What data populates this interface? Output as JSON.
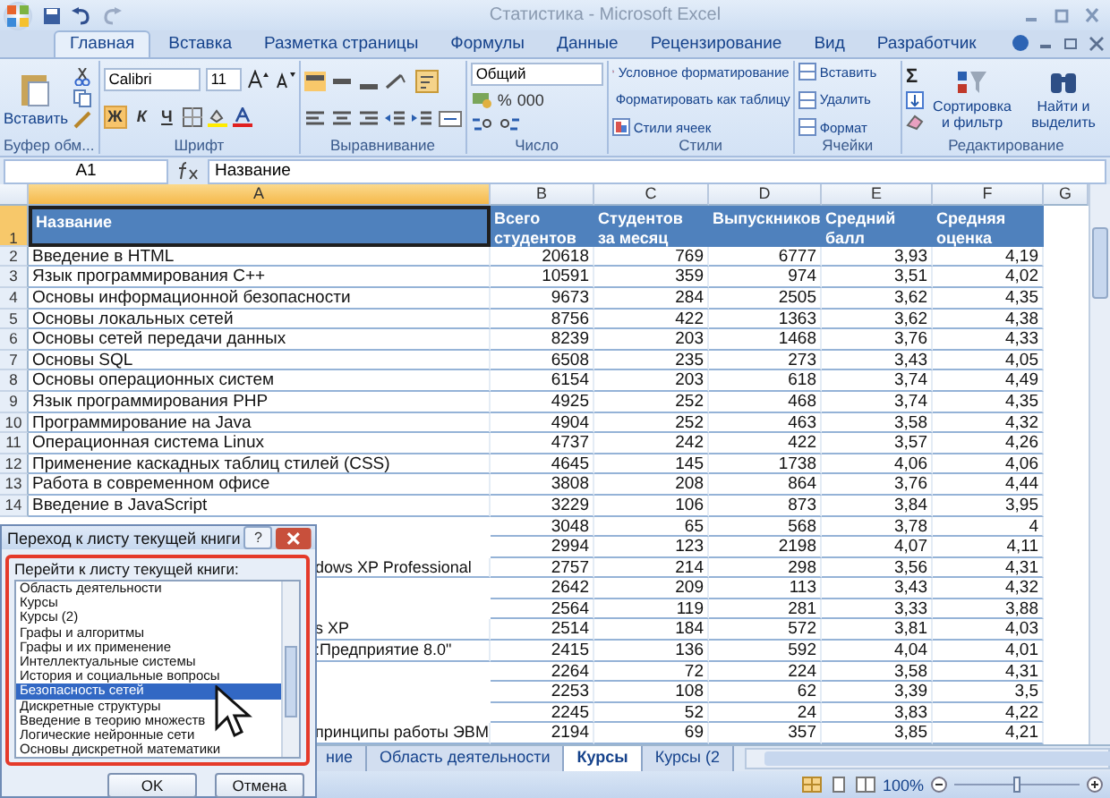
{
  "window": {
    "title": "Статистика - Microsoft Excel"
  },
  "ribbon_tabs": [
    {
      "label": "Главная",
      "selected": true
    },
    {
      "label": "Вставка",
      "selected": false
    },
    {
      "label": "Разметка страницы",
      "selected": false
    },
    {
      "label": "Формулы",
      "selected": false
    },
    {
      "label": "Данные",
      "selected": false
    },
    {
      "label": "Рецензирование",
      "selected": false
    },
    {
      "label": "Вид",
      "selected": false
    },
    {
      "label": "Разработчик",
      "selected": false
    }
  ],
  "ribbon": {
    "clipboard": {
      "paste": "Вставить",
      "group": "Буфер обм..."
    },
    "font": {
      "name": "Calibri",
      "size": "11",
      "bold": "Ж",
      "italic": "К",
      "underline": "Ч",
      "group": "Шрифт"
    },
    "alignment": {
      "group": "Выравнивание"
    },
    "number": {
      "format": "Общий",
      "percent": "%",
      "thousands": "000",
      "group": "Число"
    },
    "styles": {
      "items": [
        "Условное форматирование",
        "Форматировать как таблицу",
        "Стили ячеек"
      ],
      "group": "Стили"
    },
    "cells": {
      "items": [
        "Вставить",
        "Удалить",
        "Формат"
      ],
      "group": "Ячейки"
    },
    "editing": {
      "sum": "Σ",
      "sort": "Сортировка и фильтр",
      "find": "Найти и выделить",
      "group": "Редактирование"
    }
  },
  "formula_bar": {
    "name_box": "A1",
    "value": "Название"
  },
  "columns": [
    {
      "label": "A",
      "selected": true
    },
    {
      "label": "B",
      "selected": false
    },
    {
      "label": "C",
      "selected": false
    },
    {
      "label": "D",
      "selected": false
    },
    {
      "label": "E",
      "selected": false
    },
    {
      "label": "F",
      "selected": false
    },
    {
      "label": "G",
      "selected": false
    }
  ],
  "header_row": {
    "num": "1",
    "cells": [
      "Название",
      "Всего студентов",
      "Студентов за месяц",
      "Выпускников",
      "Средний балл",
      "Средняя оценка"
    ]
  },
  "rows": [
    {
      "num": "2",
      "name": "Введение в HTML",
      "values": [
        "20618",
        "769",
        "6777",
        "3,93",
        "4,19"
      ]
    },
    {
      "num": "3",
      "name": "Язык программирования С++",
      "values": [
        "10591",
        "359",
        "974",
        "3,51",
        "4,02"
      ]
    },
    {
      "num": "4",
      "name": "Основы информационной безопасности",
      "values": [
        "9673",
        "284",
        "2505",
        "3,62",
        "4,35"
      ]
    },
    {
      "num": "5",
      "name": "Основы локальных сетей",
      "values": [
        "8756",
        "422",
        "1363",
        "3,62",
        "4,38"
      ]
    },
    {
      "num": "6",
      "name": "Основы сетей передачи данных",
      "values": [
        "8239",
        "203",
        "1468",
        "3,76",
        "4,33"
      ]
    },
    {
      "num": "7",
      "name": "Основы SQL",
      "values": [
        "6508",
        "235",
        "273",
        "3,43",
        "4,05"
      ]
    },
    {
      "num": "8",
      "name": "Основы операционных систем",
      "values": [
        "6154",
        "203",
        "618",
        "3,74",
        "4,49"
      ]
    },
    {
      "num": "9",
      "name": "Язык программирования PHP",
      "values": [
        "4925",
        "252",
        "468",
        "3,74",
        "4,35"
      ]
    },
    {
      "num": "10",
      "name": "Программирование на Java",
      "values": [
        "4904",
        "252",
        "463",
        "3,58",
        "4,32"
      ]
    },
    {
      "num": "11",
      "name": "Операционная система Linux",
      "values": [
        "4737",
        "242",
        "422",
        "3,57",
        "4,26"
      ]
    },
    {
      "num": "12",
      "name": "Применение каскадных таблиц стилей (CSS)",
      "values": [
        "4645",
        "145",
        "1738",
        "4,06",
        "4,06"
      ]
    },
    {
      "num": "13",
      "name": "Работа в современном офисе",
      "values": [
        "3808",
        "208",
        "864",
        "3,76",
        "4,44"
      ]
    },
    {
      "num": "14",
      "name": "Введение в JavaScript",
      "values": [
        "3229",
        "106",
        "873",
        "3,84",
        "3,95"
      ]
    },
    {
      "values": [
        "3048",
        "65",
        "568",
        "3,78",
        "4"
      ]
    },
    {
      "values": [
        "2994",
        "123",
        "2198",
        "4,07",
        "4,11"
      ]
    },
    {
      "name_tail": "dows XP Professional",
      "values": [
        "2757",
        "214",
        "298",
        "3,56",
        "4,31"
      ]
    },
    {
      "values": [
        "2642",
        "209",
        "113",
        "3,43",
        "4,32"
      ]
    },
    {
      "values": [
        "2564",
        "119",
        "281",
        "3,33",
        "3,88"
      ]
    },
    {
      "name_tail": "s XP",
      "values": [
        "2514",
        "184",
        "572",
        "3,81",
        "4,03"
      ]
    },
    {
      "name_tail": ":Предприятие 8.0\"",
      "values": [
        "2415",
        "136",
        "592",
        "4,04",
        "4,01"
      ]
    },
    {
      "values": [
        "2264",
        "72",
        "224",
        "3,58",
        "4,31"
      ]
    },
    {
      "values": [
        "2253",
        "108",
        "62",
        "3,39",
        "3,5"
      ]
    },
    {
      "values": [
        "2245",
        "52",
        "24",
        "3,83",
        "4,22"
      ]
    },
    {
      "name_tail": "принципы работы ЭВМ",
      "values": [
        "2194",
        "69",
        "357",
        "3,85",
        "4,21"
      ]
    }
  ],
  "dialog": {
    "title": "Переход к листу текущей книги",
    "help": "?",
    "label": "Перейти к листу текущей книги:",
    "items": [
      {
        "label": "Область деятельности",
        "selected": false
      },
      {
        "label": "Курсы",
        "selected": false
      },
      {
        "label": "Курсы (2)",
        "selected": false
      },
      {
        "label": "Графы и алгоритмы",
        "selected": false
      },
      {
        "label": "Графы и их применение",
        "selected": false
      },
      {
        "label": "Интеллектуальные системы",
        "selected": false
      },
      {
        "label": "История и социальные вопросы",
        "selected": false
      },
      {
        "label": "Безопасность сетей",
        "selected": true
      },
      {
        "label": "Дискретные структуры",
        "selected": false
      },
      {
        "label": "Введение в теорию множеств",
        "selected": false
      },
      {
        "label": "Логические нейронные сети",
        "selected": false
      },
      {
        "label": "Основы дискретной математики",
        "selected": false
      }
    ],
    "buttons": [
      "OK",
      "Отмена"
    ]
  },
  "sheet_tabs": [
    {
      "label": "ние",
      "selected": false
    },
    {
      "label": "Область деятельности",
      "selected": false
    },
    {
      "label": "Курсы",
      "selected": true
    },
    {
      "label": "Курсы (2",
      "selected": false
    }
  ],
  "status_bar": {
    "zoom": "100%",
    "level": 0.5
  }
}
